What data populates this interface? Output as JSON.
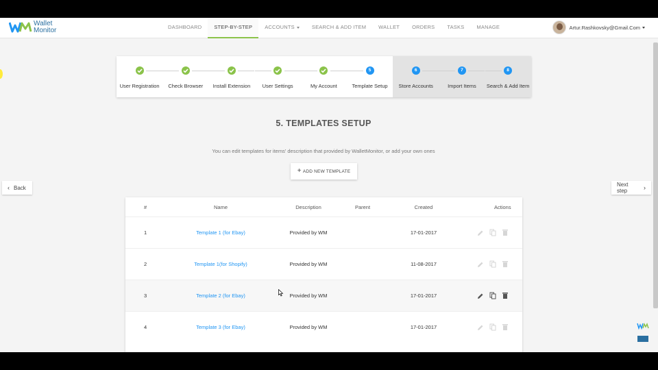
{
  "brand": {
    "line1": "Wallet",
    "line2": "Monitor",
    "colors": {
      "blue": "#2a6fa0",
      "green": "#8bc34a"
    }
  },
  "nav": {
    "items": [
      {
        "label": "DASHBOARD"
      },
      {
        "label": "STEP-BY-STEP",
        "active": true
      },
      {
        "label": "ACCOUNTS",
        "dropdown": true
      },
      {
        "label": "SEARCH & ADD ITEM"
      },
      {
        "label": "WALLET"
      },
      {
        "label": "ORDERS"
      },
      {
        "label": "TASKS"
      },
      {
        "label": "MANAGE"
      }
    ]
  },
  "user": {
    "email": "Artur.Rashkovsky@Gmail.Com"
  },
  "stepper": {
    "current_step": 5,
    "steps": [
      {
        "label": "User Registration",
        "status": "done"
      },
      {
        "label": "Check Browser",
        "status": "done"
      },
      {
        "label": "Install Extension",
        "status": "done"
      },
      {
        "label": "User Settings",
        "status": "done"
      },
      {
        "label": "My Account",
        "status": "done"
      },
      {
        "number": "5",
        "label": "Template Setup",
        "status": "current"
      },
      {
        "number": "6",
        "label": "Store Accounts",
        "status": "pending"
      },
      {
        "number": "7",
        "label": "Import Items",
        "status": "pending"
      },
      {
        "number": "8",
        "label": "Search & Add Item",
        "status": "pending"
      }
    ]
  },
  "page": {
    "title": "5. TEMPLATES SETUP",
    "subtitle": "You can edit templates for items' description that provided by WalletMonitor, or add your own ones",
    "add_button": "ADD NEW TEMPLATE",
    "back": "Back",
    "next": "Next step"
  },
  "table": {
    "headers": {
      "num": "#",
      "name": "Name",
      "description": "Description",
      "parent": "Parent",
      "created": "Created",
      "actions": "Actions"
    },
    "rows": [
      {
        "num": "1",
        "name": "Template 1 (for Ebay)",
        "description": "Provided by WM",
        "parent": "",
        "created": "17-01-2017"
      },
      {
        "num": "2",
        "name": "Template 1(for Shopify)",
        "description": "Provided by WM",
        "parent": "",
        "created": "11-08-2017"
      },
      {
        "num": "3",
        "name": "Template 2 (for Ebay)",
        "description": "Provided by WM",
        "parent": "",
        "created": "17-01-2017",
        "hovered": true
      },
      {
        "num": "4",
        "name": "Template 3 (for Ebay)",
        "description": "Provided by WM",
        "parent": "",
        "created": "17-01-2017"
      }
    ]
  },
  "icons": {
    "edit": "pencil-icon",
    "copy": "copy-icon",
    "delete": "trash-icon",
    "check": "check-icon"
  }
}
